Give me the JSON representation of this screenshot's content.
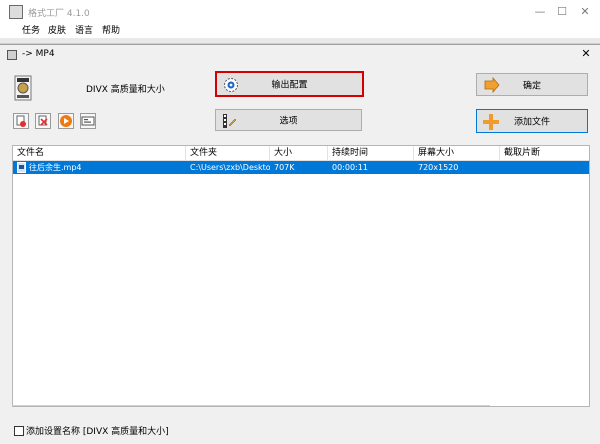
{
  "main_window": {
    "title": "格式工厂 4.1.0",
    "menu": [
      "任务",
      "皮肤",
      "语言",
      "帮助"
    ],
    "controls": {
      "minimize": "—",
      "maximize": "☐",
      "close": "✕"
    }
  },
  "dialog": {
    "title": "-> MP4",
    "close": "✕",
    "profile_label": "DIVX 高质量和大小",
    "buttons": {
      "output_config": "输出配置",
      "options": "选项",
      "ok": "确定",
      "add_file": "添加文件"
    },
    "toolbar_icons": [
      "remove-icon",
      "clear-icon",
      "play-icon",
      "media-info-icon"
    ],
    "table": {
      "columns": [
        "文件名",
        "文件夹",
        "大小",
        "持续时间",
        "屏幕大小",
        "截取片断"
      ],
      "rows": [
        {
          "name": "往后余生.mp4",
          "folder": "C:\\Users\\zxb\\Desktop",
          "size": "707K",
          "duration": "00:00:11",
          "screen": "720x1520",
          "clip": ""
        }
      ]
    },
    "save_setting_label": "添加设置名称 [DIVX 高质量和大小]"
  },
  "colors": {
    "selection": "#0078d7",
    "highlight_border": "#d40000",
    "ok_arrow": "#f0a030",
    "add_plus": "#f29a2e"
  }
}
